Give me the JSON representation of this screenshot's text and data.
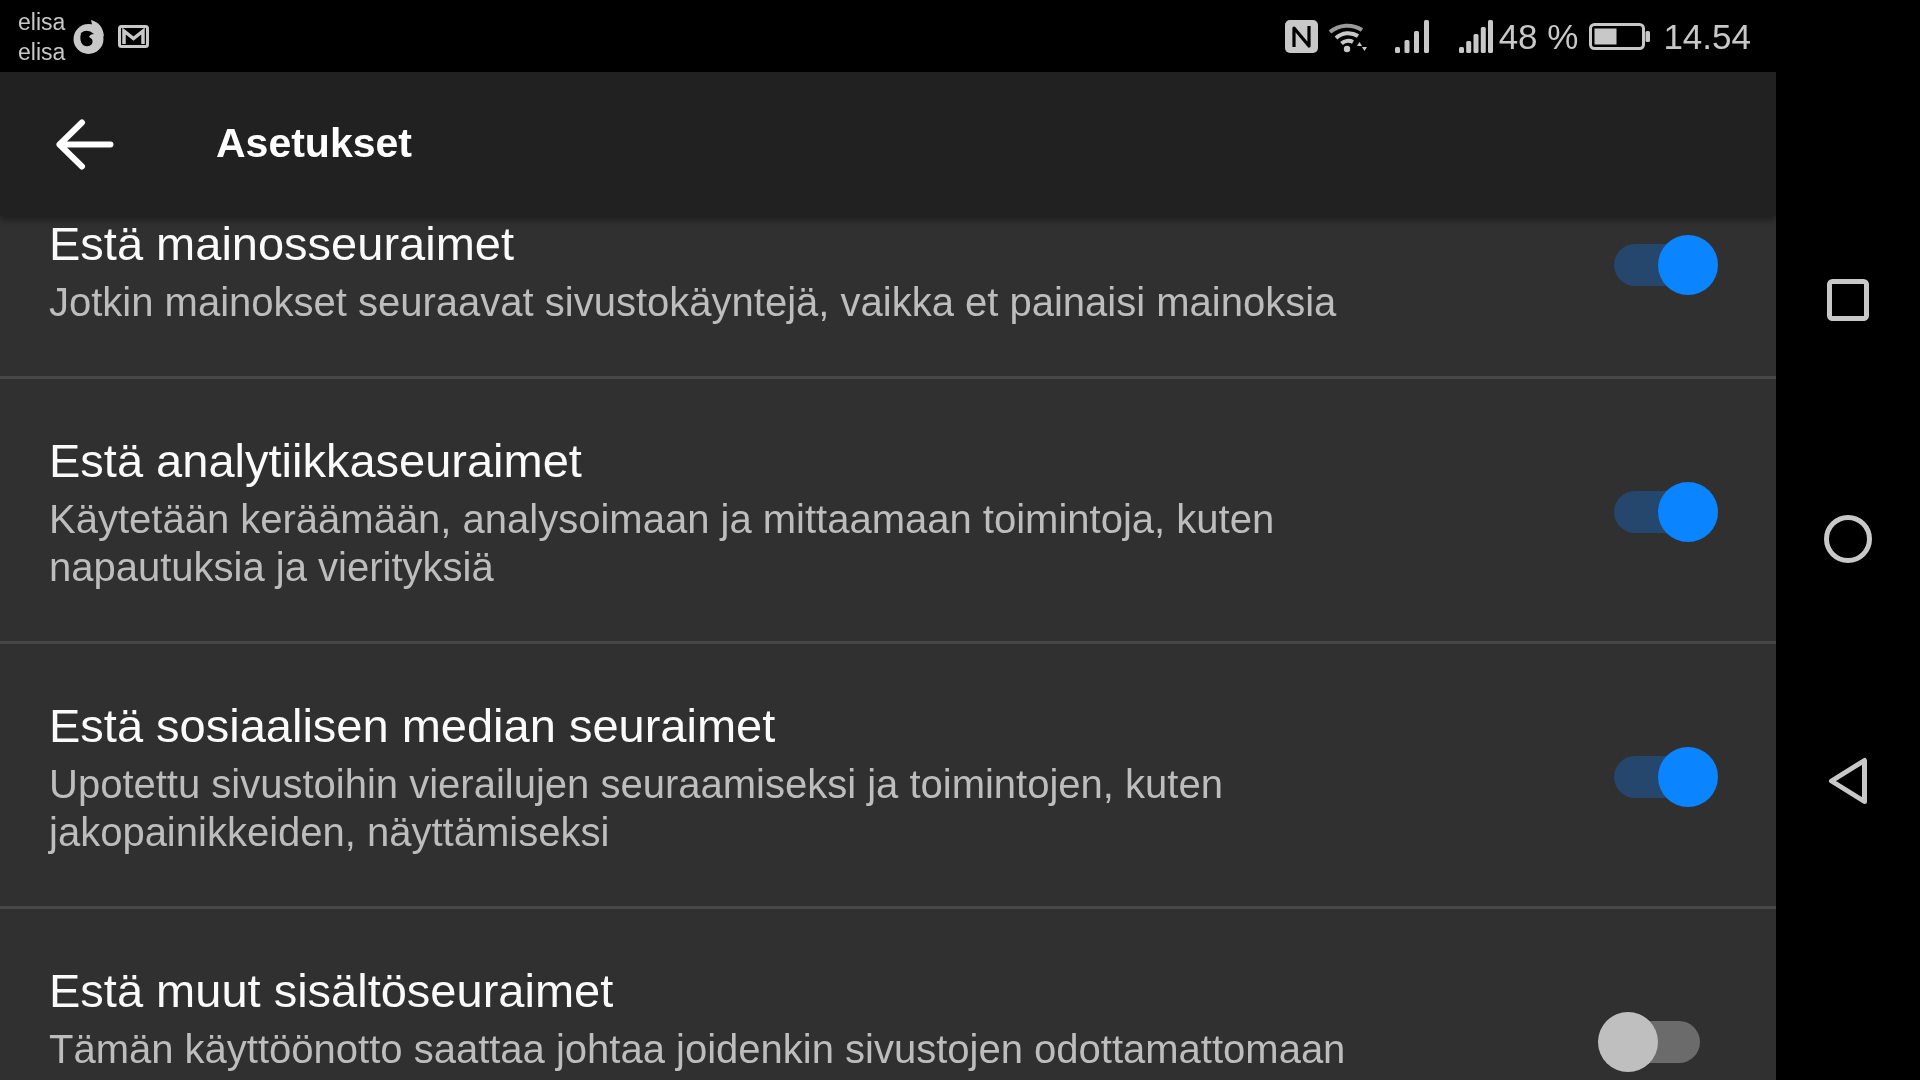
{
  "status_bar": {
    "carrier": [
      "elisa",
      "elisa"
    ],
    "battery": "48 %",
    "time": "14.54"
  },
  "app_bar": {
    "title": "Asetukset"
  },
  "settings": [
    {
      "title": "Estä mainosseuraimet",
      "description": "Jotkin mainokset seuraavat sivustokäyntejä, vaikka et painaisi mainoksia",
      "on": true
    },
    {
      "title": "Estä analytiikkaseuraimet",
      "description": "Käytetään keräämään, analysoimaan ja mittaamaan toimintoja, kuten napautuksia ja vierityksiä",
      "on": true
    },
    {
      "title": "Estä sosiaalisen median seuraimet",
      "description": "Upotettu sivustoihin vierailujen seuraamiseksi ja toimintojen, kuten jakopainikkeiden, näyttämiseksi",
      "on": true
    },
    {
      "title": "Estä muut sisältöseuraimet",
      "description": "Tämän käyttöönotto saattaa johtaa joidenkin sivustojen odottamattomaan",
      "on": false
    }
  ]
}
